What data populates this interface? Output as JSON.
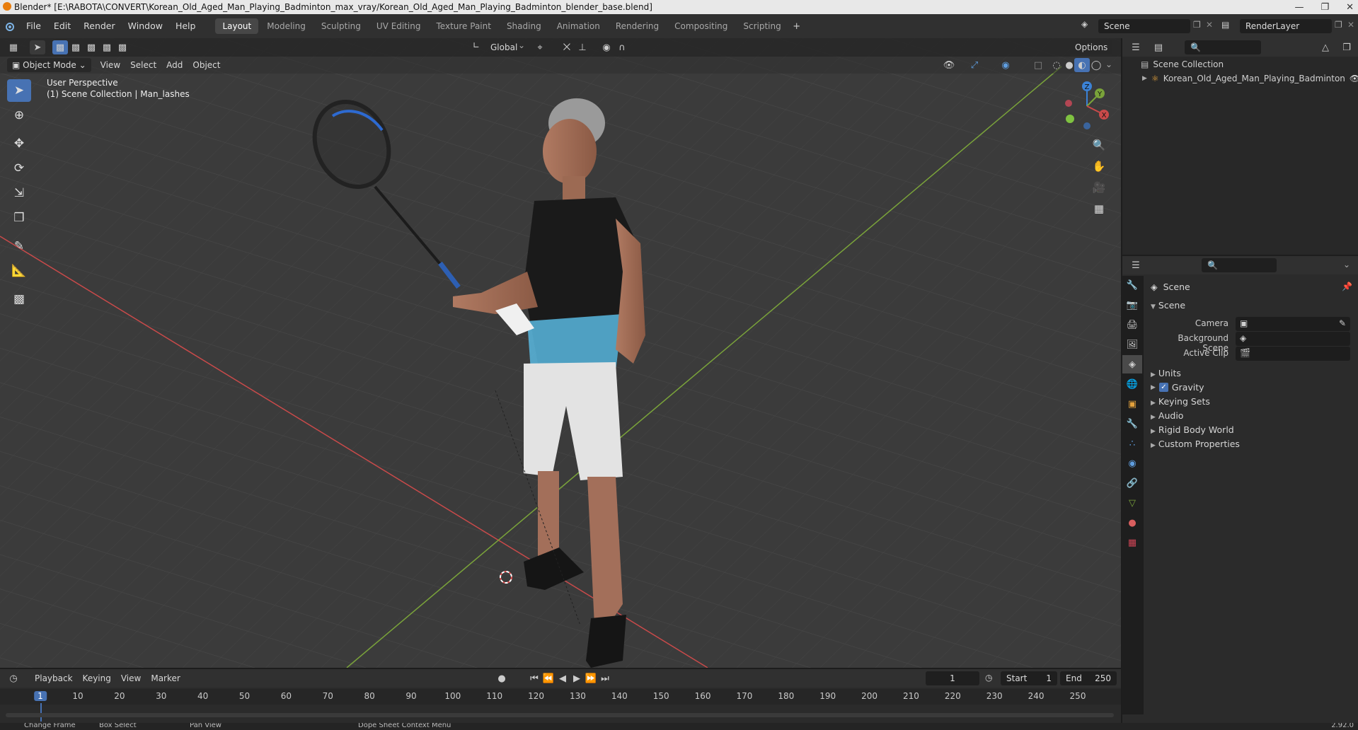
{
  "title_bar": {
    "title": "Blender* [E:\\RABOTA\\CONVERT\\Korean_Old_Aged_Man_Playing_Badminton_max_vray/Korean_Old_Aged_Man_Playing_Badminton_blender_base.blend]"
  },
  "menubar": {
    "menus": [
      "File",
      "Edit",
      "Render",
      "Window",
      "Help"
    ],
    "workspaces": [
      "Layout",
      "Modeling",
      "Sculpting",
      "UV Editing",
      "Texture Paint",
      "Shading",
      "Animation",
      "Rendering",
      "Compositing",
      "Scripting"
    ],
    "active_workspace": "Layout",
    "scene": "Scene",
    "view_layer": "RenderLayer"
  },
  "viewport": {
    "mode": "Object Mode",
    "header_menus": [
      "View",
      "Select",
      "Add",
      "Object"
    ],
    "transform_orientation": "Global",
    "options_label": "Options",
    "info_line1": "User Perspective",
    "info_line2": "(1) Scene Collection | Man_lashes",
    "gizmo": {
      "x": "X",
      "y": "Y",
      "z": "Z"
    },
    "colors": {
      "x_axis": "#c94a4a",
      "y_axis": "#7aa33a",
      "z_axis": "#3b82d6"
    }
  },
  "outliner": {
    "root": "Scene Collection",
    "items": [
      "Korean_Old_Aged_Man_Playing_Badminton"
    ]
  },
  "properties": {
    "context": "Scene",
    "panel_title": "Scene",
    "fields": [
      {
        "label": "Camera"
      },
      {
        "label": "Background Scene"
      },
      {
        "label": "Active Clip"
      }
    ],
    "sections": [
      "Units",
      "Gravity",
      "Keying Sets",
      "Audio",
      "Rigid Body World",
      "Custom Properties"
    ],
    "gravity_checked": true
  },
  "timeline": {
    "menus": [
      "Playback",
      "Keying",
      "View",
      "Marker"
    ],
    "current_frame": "1",
    "start_label": "Start",
    "start": "1",
    "end_label": "End",
    "end": "250",
    "ruler": [
      "1",
      "10",
      "20",
      "30",
      "40",
      "50",
      "60",
      "70",
      "80",
      "90",
      "100",
      "110",
      "120",
      "130",
      "140",
      "150",
      "160",
      "170",
      "180",
      "190",
      "200",
      "210",
      "220",
      "230",
      "240",
      "250"
    ]
  },
  "statusbar": {
    "items": [
      "Change Frame",
      "Box Select",
      "Pan View",
      "Dope Sheet Context Menu"
    ],
    "version": "2.92.0"
  }
}
